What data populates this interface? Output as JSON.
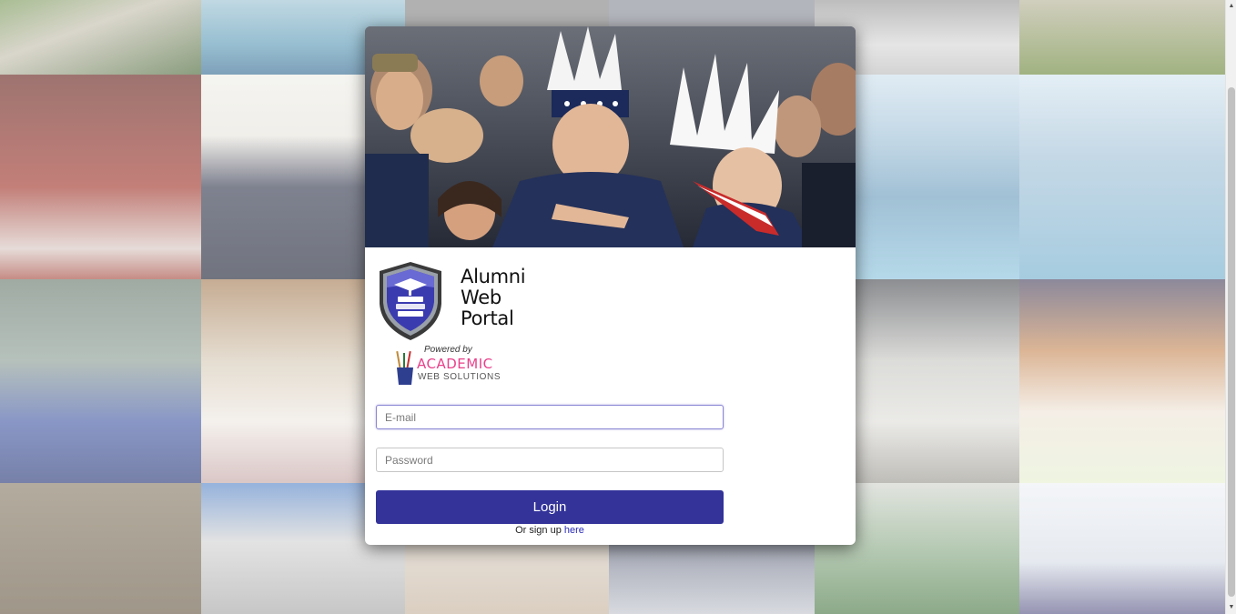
{
  "brand": {
    "title_lines": [
      "Alumni",
      "Web",
      "Portal"
    ],
    "powered_by": "Powered by",
    "company_name": "ACADEMIC",
    "company_sub": "WEB SOLUTIONS",
    "shield_color": "#3b3bb0",
    "accent_pink": "#e8408a"
  },
  "form": {
    "email_placeholder": "E-mail",
    "password_placeholder": "Password",
    "login_label": "Login",
    "signup_prefix": "Or sign up ",
    "signup_link": "here"
  },
  "colors": {
    "primary_button": "#33339a",
    "link": "#2a2ab8"
  },
  "icons": {
    "logo": "graduation-cap-books-shield-icon",
    "company_logo": "pencil-cup-icon"
  }
}
